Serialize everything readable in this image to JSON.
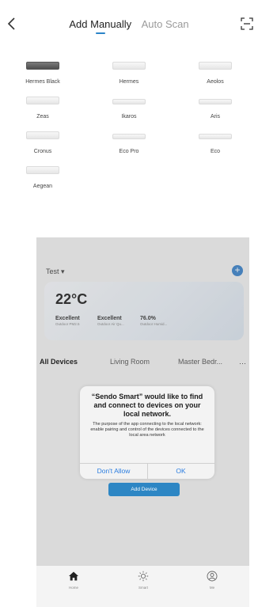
{
  "header": {
    "tabs": [
      {
        "label": "Add Manually",
        "active": true
      },
      {
        "label": "Auto Scan",
        "active": false
      }
    ],
    "icons": {
      "back": "chevron-left-icon",
      "scan": "scan-icon"
    }
  },
  "models": [
    {
      "name": "Hermes Black",
      "tone": "dark"
    },
    {
      "name": "Hermes",
      "tone": "light"
    },
    {
      "name": "Aeolos",
      "tone": "light"
    },
    {
      "name": "Zeas",
      "tone": "light"
    },
    {
      "name": "Ikaros",
      "tone": "light"
    },
    {
      "name": "Aris",
      "tone": "light"
    },
    {
      "name": "Cronus",
      "tone": "light"
    },
    {
      "name": "Eco Pro",
      "tone": "light"
    },
    {
      "name": "Eco",
      "tone": "light"
    },
    {
      "name": "Aegean",
      "tone": "light"
    }
  ],
  "home": {
    "home_name": "Test",
    "weather": {
      "temperature": "22°C",
      "stats": [
        {
          "value": "Excellent",
          "label": "Outdoor PM2.5"
        },
        {
          "value": "Excellent",
          "label": "Outdoor Air Qu..."
        },
        {
          "value": "76.0%",
          "label": "Outdoor Humid..."
        }
      ]
    },
    "rooms": [
      "All Devices",
      "Living Room",
      "Master Bedr..."
    ],
    "add_device_label": "Add Device",
    "nav": [
      {
        "label": "Home",
        "icon": "home-icon",
        "active": true
      },
      {
        "label": "Smart",
        "icon": "sun-icon",
        "active": false
      },
      {
        "label": "Me",
        "icon": "profile-icon",
        "active": false
      }
    ]
  },
  "dialog": {
    "title": "“Sendo Smart” would like to find and connect to devices on your local network.",
    "message": "The purpose of the app connecting to the local network: enable pairing and control of the devices connected to the local area network",
    "deny_label": "Don't Allow",
    "ok_label": "OK"
  },
  "colors": {
    "accent": "#2d86c4",
    "link": "#2b7de0",
    "tab_indicator": "#2a84c8"
  }
}
